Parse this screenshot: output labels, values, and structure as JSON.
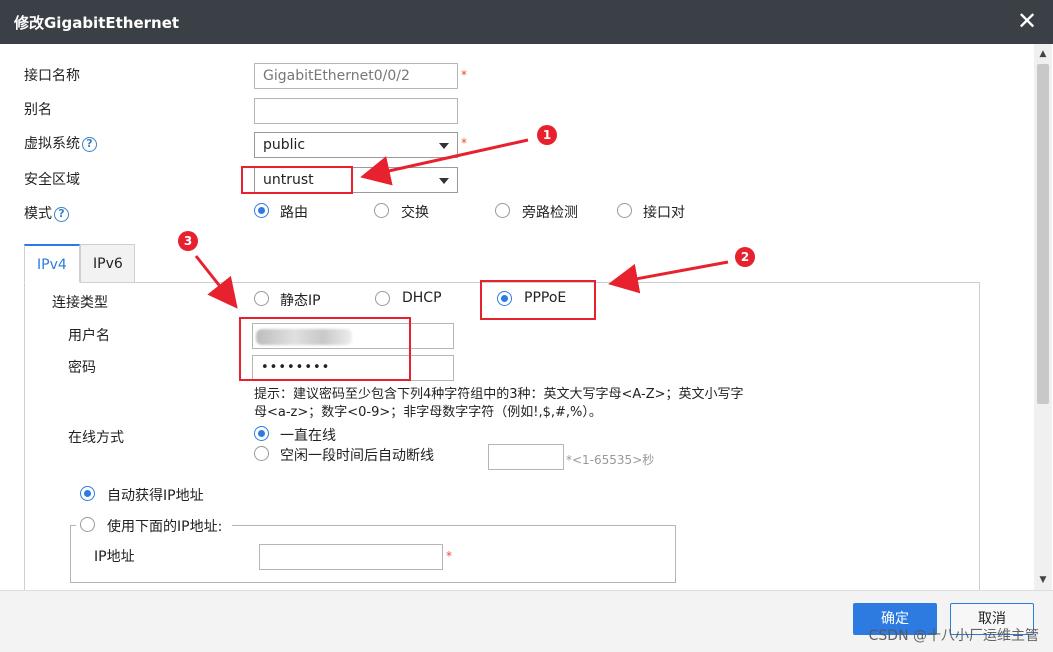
{
  "dialog": {
    "title": "修改GigabitEthernet",
    "close_glyph": "✕"
  },
  "form": {
    "interface_name": {
      "label": "接口名称",
      "value": "GigabitEthernet0/0/2"
    },
    "alias": {
      "label": "别名",
      "value": ""
    },
    "virtual_system": {
      "label": "虚拟系统",
      "value": "public"
    },
    "security_zone": {
      "label": "安全区域",
      "value": "untrust"
    },
    "mode": {
      "label": "模式",
      "options": [
        "路由",
        "交换",
        "旁路检测",
        "接口对"
      ],
      "selected": "路由"
    },
    "required_mark": "*",
    "help_glyph": "?"
  },
  "tabs": [
    {
      "label": "IPv4",
      "active": true
    },
    {
      "label": "IPv6",
      "active": false
    }
  ],
  "ipv4": {
    "connection_type": {
      "label": "连接类型",
      "options": [
        "静态IP",
        "DHCP",
        "PPPoE"
      ],
      "selected": "PPPoE"
    },
    "username": {
      "label": "用户名",
      "value": ""
    },
    "password": {
      "label": "密码",
      "value": "••••••••"
    },
    "hint": "提示：建议密码至少包含下列4种字符组中的3种：英文大写字母<A-Z>；英文小写字母<a-z>；数字<0-9>；非字母数字字符（例如!,$,#,%）。",
    "online_mode": {
      "label": "在线方式",
      "options": [
        "一直在线",
        "空闲一段时间后自动断线"
      ],
      "selected": "一直在线",
      "idle_range": "*<1-65535>秒"
    },
    "ip_auto": "自动获得IP地址",
    "ip_manual": "使用下面的IP地址:",
    "ip_address_label": "IP地址"
  },
  "annotations": {
    "badge1": "1",
    "badge2": "2",
    "badge3": "3",
    "color": "#e8212f"
  },
  "footer": {
    "ok": "确定",
    "cancel": "取消",
    "watermark": "CSDN @十八小厂运维主管"
  }
}
